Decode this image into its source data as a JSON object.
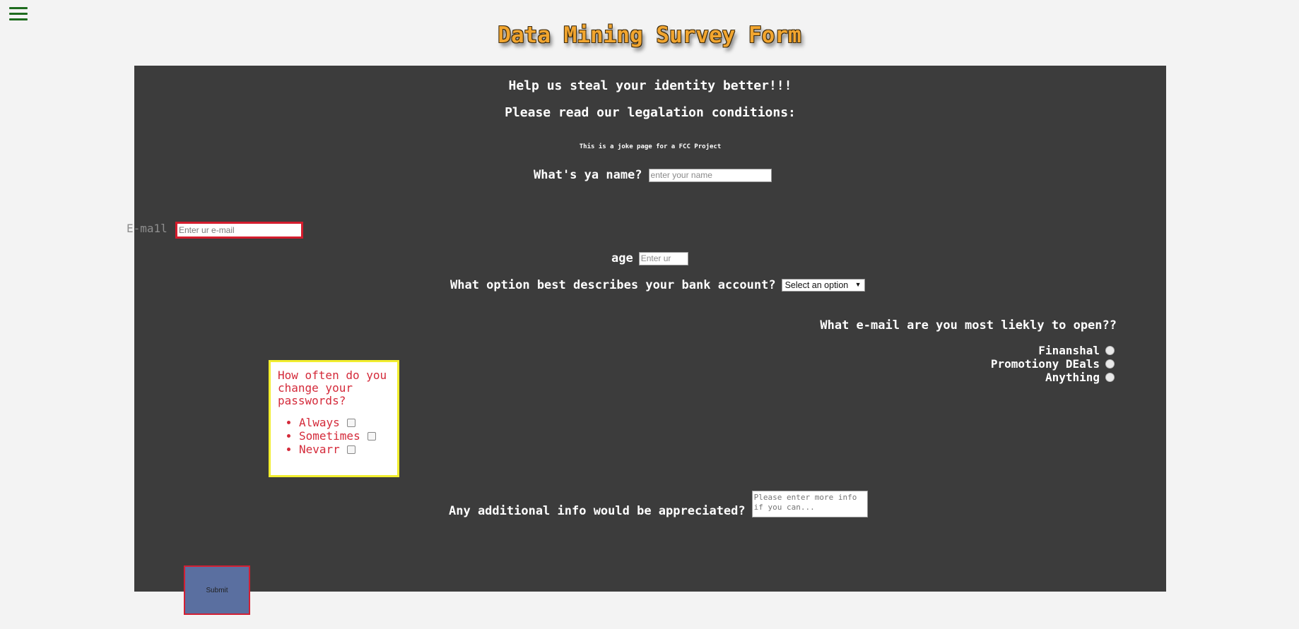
{
  "header": {
    "title": "Data Mining Survey Form",
    "menu_icon": "hamburger-menu-icon"
  },
  "intro": {
    "line1": "Help us steal your identity better!!!",
    "line2": "Please read our legalation conditions:",
    "note": "This is a joke page for a FCC Project"
  },
  "name_field": {
    "label": "What's ya name?",
    "placeholder": "enter your name"
  },
  "email_field": {
    "label": "E-ma1l",
    "placeholder": "Enter ur e-mail"
  },
  "age_field": {
    "label": "age",
    "placeholder": "Enter ur"
  },
  "bank_field": {
    "label": "What option best describes your bank account?",
    "selected": "Select an option"
  },
  "email_pref": {
    "question": "What e-mail are you most liekly to open??",
    "options": [
      "Finanshal",
      "Promotiony DEals",
      "Anything"
    ]
  },
  "password_box": {
    "question": "How often do you change your passwords?",
    "options": [
      "Always",
      "Sometimes",
      "Nevarr"
    ]
  },
  "info_field": {
    "label": "Any additional info would be appreciated?",
    "placeholder": "Please enter more info if you can..."
  },
  "submit": {
    "label": "Submit"
  },
  "colors": {
    "page_bg": "#f3f3f3",
    "panel_bg": "#3c3c3c",
    "title": "#f1a52f",
    "email_border": "#d31c2d",
    "password_text": "#d42a3a",
    "password_border": "#f2ee2f",
    "submit_bg": "#5a6fa0"
  }
}
